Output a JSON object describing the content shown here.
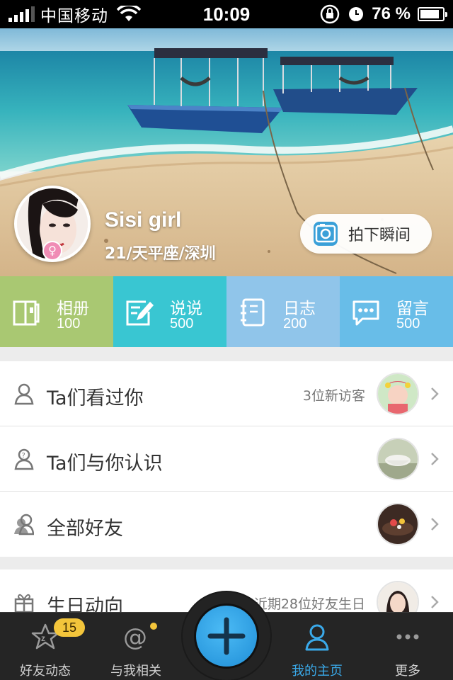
{
  "status_bar": {
    "carrier": "中国移动",
    "time": "10:09",
    "battery": "76 %",
    "battery_level": 0.76,
    "signal_bars": 4
  },
  "profile": {
    "name": "Sisi girl",
    "info": "21/天平座/深圳",
    "gender_icon": "female-symbol-icon",
    "snap_label": "拍下瞬间"
  },
  "stats": [
    {
      "label": "相册",
      "count": "100",
      "color": "#a9c872",
      "icon": "album-icon"
    },
    {
      "label": "说说",
      "count": "500",
      "color": "#39c6d2",
      "icon": "edit-icon"
    },
    {
      "label": "日志",
      "count": "200",
      "color": "#90c5ea",
      "icon": "notebook-icon"
    },
    {
      "label": "留言",
      "count": "500",
      "color": "#68bde8",
      "icon": "chat-icon"
    }
  ],
  "list": [
    {
      "title": "Ta们看过你",
      "aside": "3位新访客",
      "icon": "person-icon"
    },
    {
      "title": "Ta们与你认识",
      "aside": "",
      "icon": "person-question-icon"
    },
    {
      "title": "全部好友",
      "aside": "",
      "icon": "friends-icon"
    },
    {
      "title": "生日动向",
      "aside": "近期28位好友生日",
      "icon": "gift-icon"
    }
  ],
  "tabbar": {
    "items": [
      {
        "label": "好友动态",
        "badge": "15",
        "icon": "star-z-icon"
      },
      {
        "label": "与我相关",
        "icon": "at-icon"
      },
      {
        "label": "我的主页",
        "icon": "profile-icon",
        "active": true
      },
      {
        "label": "更多",
        "icon": "more-dots-icon"
      }
    ],
    "accent": "#3aa9e9",
    "badge_color": "#f3c53b"
  }
}
